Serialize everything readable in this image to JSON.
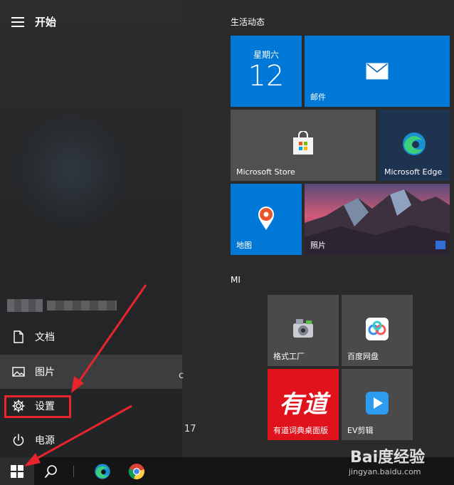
{
  "start": {
    "title": "开始"
  },
  "sidebar": {
    "items": [
      {
        "label": "文档",
        "icon": "document-icon"
      },
      {
        "label": "图片",
        "icon": "picture-icon"
      },
      {
        "label": "设置",
        "icon": "gear-icon"
      },
      {
        "label": "电源",
        "icon": "power-icon"
      }
    ],
    "partial_text": {
      "c": "c",
      "y": "17"
    }
  },
  "groups": [
    {
      "label": "生活动态",
      "tiles": [
        {
          "type": "calendar",
          "day_name": "星期六",
          "day_number": "12",
          "color": "#0078d7"
        },
        {
          "label": "邮件",
          "icon": "mail-icon",
          "color": "#0078d7"
        },
        {
          "label": "Microsoft Store",
          "icon": "store-bag-icon",
          "color": "#505050"
        },
        {
          "label": "Microsoft Edge",
          "icon": "edge-icon",
          "color": "#1e3350"
        },
        {
          "label": "地图",
          "icon": "map-pin-icon",
          "color": "#0078d7"
        },
        {
          "label": "照片",
          "icon": "photo-landscape",
          "color": "#6b3a4e"
        }
      ]
    },
    {
      "label": "MI",
      "tiles": [
        {
          "label": "格式工厂",
          "icon": "format-factory-icon",
          "color": "#4a4a4a"
        },
        {
          "label": "百度网盘",
          "icon": "baidu-netdisk-icon",
          "color": "#4a4a4a"
        },
        {
          "label": "有道词典桌面版",
          "icon": "youdao-logo",
          "logo_text": "有道",
          "color": "#e0131c"
        },
        {
          "label": "EV剪辑",
          "icon": "ev-play-icon",
          "color": "#4a4a4a"
        }
      ]
    }
  ],
  "taskbar": {
    "items": [
      "windows-start-icon",
      "search-icon",
      "edge-icon",
      "chrome-icon"
    ]
  },
  "watermark": {
    "main": "Bai度经验",
    "sub": "jingyan.baidu.com"
  },
  "colors": {
    "accent": "#0078d7",
    "highlight_red": "#e8252d"
  }
}
